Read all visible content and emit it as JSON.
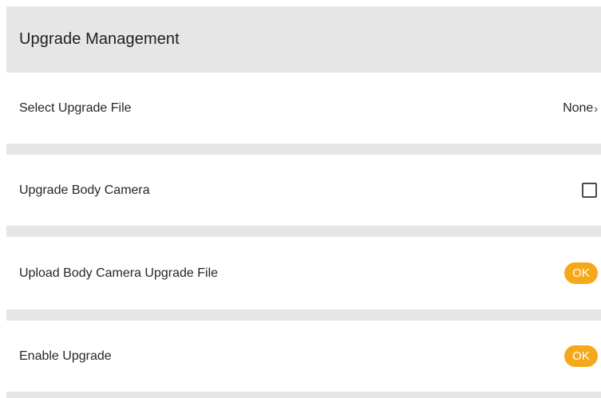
{
  "header": {
    "title": "Upgrade Management"
  },
  "rows": [
    {
      "label": "Select Upgrade File",
      "control": "value-link",
      "value": "None",
      "chevron": "›"
    },
    {
      "label": "Upgrade Body Camera",
      "control": "checkbox",
      "checked": false
    },
    {
      "label": "Upload Body Camera Upgrade File",
      "control": "button",
      "button_label": "OK"
    },
    {
      "label": "Enable Upgrade",
      "control": "button",
      "button_label": "OK"
    }
  ],
  "colors": {
    "header_bg": "#e6e6e6",
    "separator": "#e6e6e6",
    "accent_button": "#f5a81a",
    "text": "#262626"
  },
  "icons": {
    "chevron": "chevron-right-icon"
  }
}
